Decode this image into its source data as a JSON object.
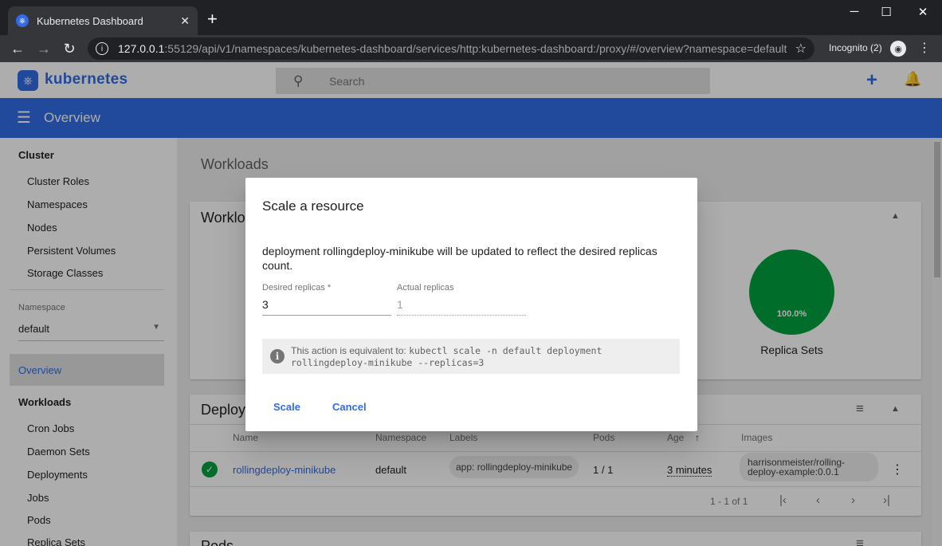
{
  "browser": {
    "tab_title": "Kubernetes Dashboard",
    "url_host": "127.0.0.1",
    "url_rest": ":55129/api/v1/namespaces/kubernetes-dashboard/services/http:kubernetes-dashboard:/proxy/#/overview?namespace=default",
    "incognito_label": "Incognito (2)"
  },
  "header": {
    "brand": "kubernetes",
    "search_placeholder": "Search"
  },
  "bluebar": {
    "title": "Overview"
  },
  "sidebar": {
    "cluster_title": "Cluster",
    "cluster_items": [
      "Cluster Roles",
      "Namespaces",
      "Nodes",
      "Persistent Volumes",
      "Storage Classes"
    ],
    "namespace_label": "Namespace",
    "namespace_value": "default",
    "overview": "Overview",
    "workloads_title": "Workloads",
    "workload_items": [
      "Cron Jobs",
      "Daemon Sets",
      "Deployments",
      "Jobs",
      "Pods",
      "Replica Sets"
    ]
  },
  "main": {
    "title": "Workloads",
    "workloads_card_title": "Workloads",
    "replica_sets_percent": "100.0%",
    "replica_sets_caption": "Replica Sets",
    "deployments_title": "Deployments",
    "columns": [
      "Name",
      "Namespace",
      "Labels",
      "Pods",
      "Age",
      "Images"
    ],
    "row": {
      "name": "rollingdeploy-minikube",
      "namespace": "default",
      "label": "app: rollingdeploy-minikube",
      "pods": "1 / 1",
      "age": "3 minutes",
      "image": "harrisonmeister/rolling-deploy-example:0.0.1"
    },
    "pager": "1 - 1 of 1",
    "pods_title": "Pods"
  },
  "dialog": {
    "title": "Scale a resource",
    "message": "deployment rollingdeploy-minikube will be updated to reflect the desired replicas count.",
    "desired_label": "Desired replicas *",
    "desired_value": "3",
    "actual_label": "Actual replicas",
    "actual_value": "1",
    "info_prefix": "This action is equivalent to: ",
    "info_command": "kubectl scale -n default deployment rollingdeploy-minikube --replicas=3",
    "scale_label": "Scale",
    "cancel_label": "Cancel"
  },
  "colors": {
    "k8s_blue": "#326ce5",
    "success_green": "#00a33e"
  }
}
